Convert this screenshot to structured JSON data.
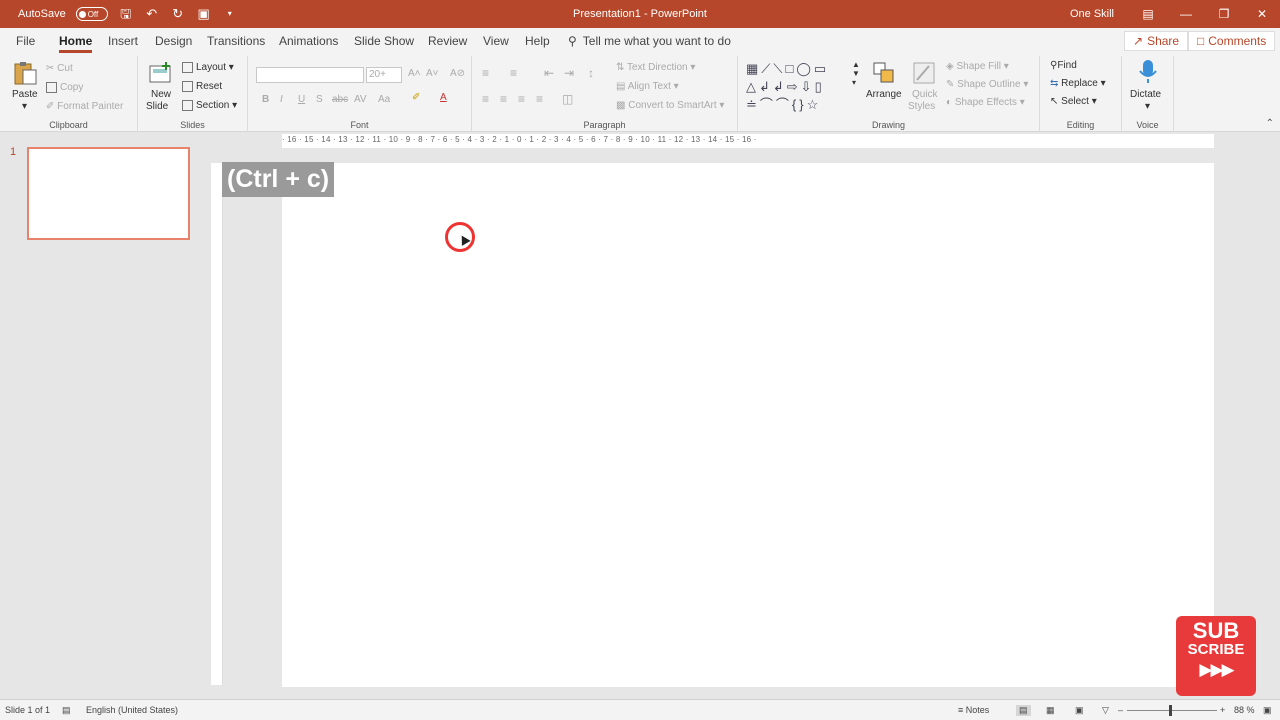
{
  "titlebar": {
    "autosave_label": "AutoSave",
    "autosave_state": "Off",
    "doc_title": "Presentation1 - PowerPoint",
    "user": "One Skill",
    "bg_color": "#b7472a"
  },
  "tabs": {
    "items": [
      "File",
      "Home",
      "Insert",
      "Design",
      "Transitions",
      "Animations",
      "Slide Show",
      "Review",
      "View",
      "Help"
    ],
    "active": "Home",
    "tell_me": "Tell me what you want to do",
    "share": "Share",
    "comments": "Comments"
  },
  "ribbon": {
    "clipboard": {
      "label": "Clipboard",
      "paste": "Paste",
      "cut": "Cut",
      "copy": "Copy",
      "format_painter": "Format Painter"
    },
    "slides": {
      "label": "Slides",
      "new_slide_1": "New",
      "new_slide_2": "Slide",
      "layout": "Layout",
      "reset": "Reset",
      "section": "Section"
    },
    "font": {
      "label": "Font",
      "size": "20+",
      "grow": "A˄",
      "shrink": "A˅",
      "bold": "B",
      "italic": "I",
      "underline": "U",
      "shadow": "S",
      "strike": "abc",
      "spacing": "AV",
      "case": "Aa"
    },
    "paragraph": {
      "label": "Paragraph",
      "text_direction": "Text Direction",
      "align_text": "Align Text",
      "smartart": "Convert to SmartArt"
    },
    "drawing": {
      "label": "Drawing",
      "arrange": "Arrange",
      "quick_styles_1": "Quick",
      "quick_styles_2": "Styles",
      "shape_fill": "Shape Fill",
      "shape_outline": "Shape Outline",
      "shape_effects": "Shape Effects"
    },
    "editing": {
      "label": "Editing",
      "find": "Find",
      "replace": "Replace",
      "select": "Select"
    },
    "voice": {
      "label": "Voice",
      "dictate": "Dictate"
    }
  },
  "ruler": {
    "horizontal": "· 16 · 15 · 14 · 13 · 12 · 11 · 10 · 9 · 8 · 7 · 6 · 5 · 4 · 3 · 2 · 1 · 0 · 1 · 2 · 3 · 4 · 5 · 6 · 7 · 8 · 9 · 10 · 11 · 12 · 13 · 14 · 15 · 16 ·"
  },
  "thumbnails": {
    "slide_number": "1"
  },
  "overlay": {
    "shortcut": "(Ctrl + c)"
  },
  "statusbar": {
    "slide_info": "Slide 1 of 1",
    "language": "English (United States)",
    "notes": "Notes",
    "zoom": "88 %"
  },
  "badge": {
    "line1": "SUB",
    "line2": "SCRIBE",
    "arrows": "▶▶▶"
  }
}
